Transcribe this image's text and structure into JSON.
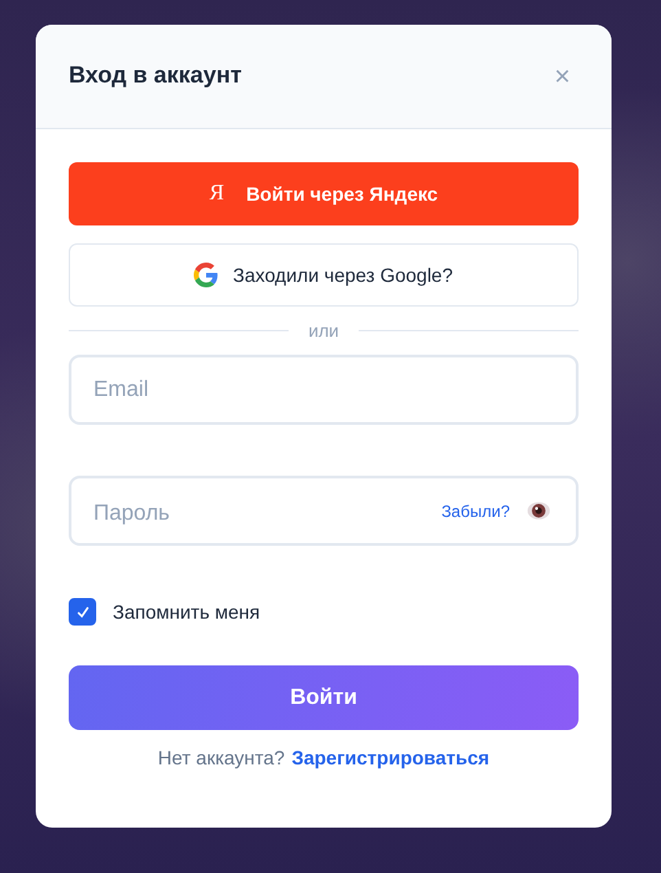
{
  "dialog": {
    "title": "Вход в аккаунт",
    "close": "×"
  },
  "yandex_button": {
    "icon": "Я",
    "label": "Войти через Яндекс"
  },
  "google_button": {
    "label": "Заходили через Google?"
  },
  "divider": "или",
  "email": {
    "placeholder": "Email"
  },
  "password": {
    "placeholder": "Пароль",
    "forgot": "Забыли?"
  },
  "remember": {
    "label": "Запомнить меня",
    "checked": true
  },
  "submit": "Войти",
  "footer": {
    "text": "Нет аккаунта?",
    "link": "Зарегистрироваться"
  }
}
